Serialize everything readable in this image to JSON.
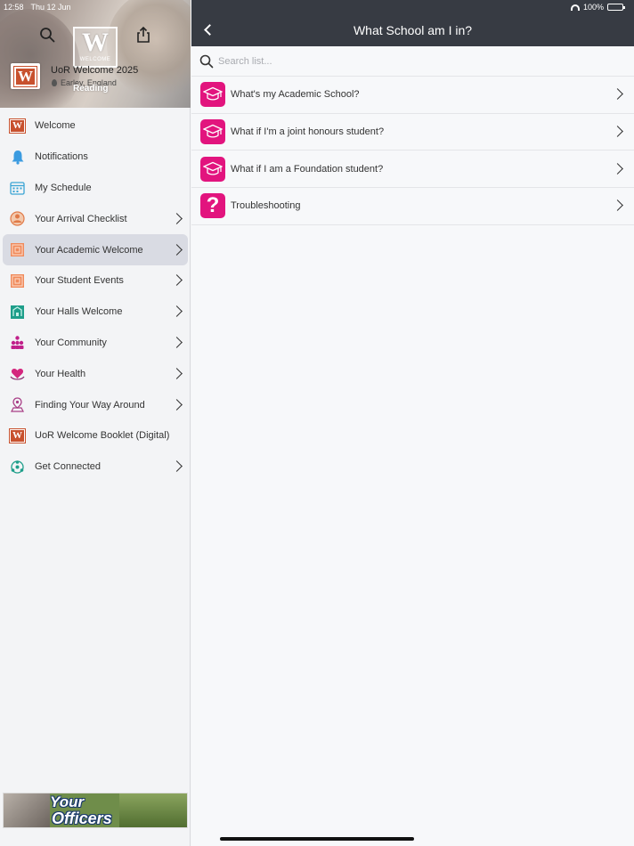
{
  "status_bar": {
    "time": "12:58",
    "date": "Thu 12 Jun",
    "battery": "100%"
  },
  "sidebar": {
    "app_title": "UoR Welcome 2025",
    "location": "Earley, England",
    "badge_letter": "W",
    "badge_text": "WELCOME",
    "reading_mark": "Reading",
    "items": [
      {
        "label": "Welcome",
        "icon": "w-logo-icon",
        "chevron": false,
        "active": false
      },
      {
        "label": "Notifications",
        "icon": "bell-icon",
        "chevron": false,
        "active": false
      },
      {
        "label": "My Schedule",
        "icon": "calendar-icon",
        "chevron": false,
        "active": false
      },
      {
        "label": "Your Arrival Checklist",
        "icon": "crest-icon",
        "chevron": true,
        "active": false
      },
      {
        "label": "Your Academic Welcome",
        "icon": "pattern-icon",
        "chevron": true,
        "active": true
      },
      {
        "label": "Your Student Events",
        "icon": "pattern-icon",
        "chevron": true,
        "active": false
      },
      {
        "label": "Your Halls Welcome",
        "icon": "halls-icon",
        "chevron": true,
        "active": false
      },
      {
        "label": "Your Community",
        "icon": "community-icon",
        "chevron": true,
        "active": false
      },
      {
        "label": "Your Health",
        "icon": "health-icon",
        "chevron": true,
        "active": false
      },
      {
        "label": "Finding Your Way Around",
        "icon": "map-icon",
        "chevron": true,
        "active": false
      },
      {
        "label": "UoR Welcome Booklet (Digital)",
        "icon": "w-logo-icon",
        "chevron": false,
        "active": false
      },
      {
        "label": "Get Connected",
        "icon": "network-icon",
        "chevron": true,
        "active": false
      }
    ],
    "banner": {
      "line1": "Your",
      "line2": "Officers"
    }
  },
  "main": {
    "title": "What School am I in?",
    "search_placeholder": "Search list...",
    "items": [
      {
        "label": "What's my Academic School?",
        "icon": "mortarboard-icon"
      },
      {
        "label": "What if I'm a joint honours student?",
        "icon": "mortarboard-icon"
      },
      {
        "label": "What if I am a Foundation student?",
        "icon": "mortarboard-icon"
      },
      {
        "label": "Troubleshooting",
        "icon": "question-icon",
        "glyph": "?"
      }
    ]
  },
  "colors": {
    "navbar": "#373b43",
    "accent_pink": "#e2147e",
    "uor_orange": "#c8512e",
    "sidebar_active": "#d9dbe3"
  }
}
